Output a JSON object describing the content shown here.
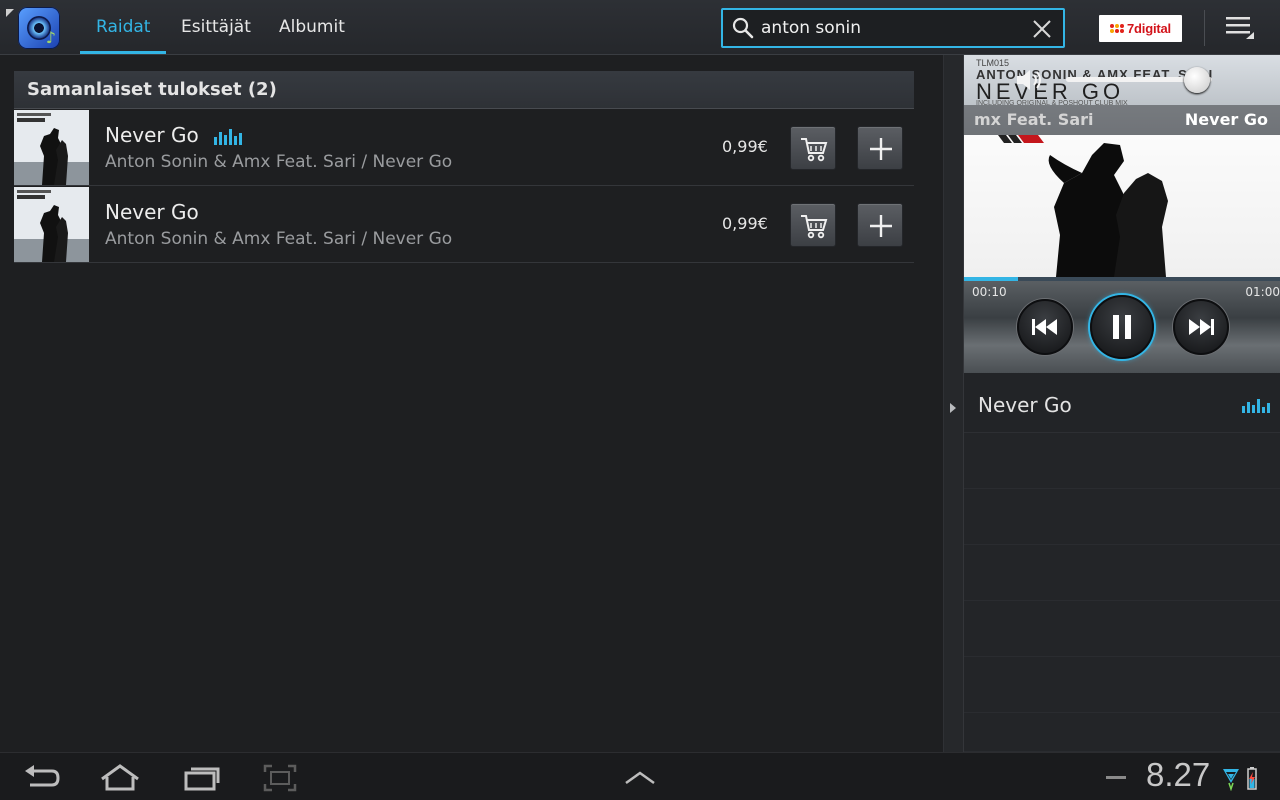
{
  "app": {
    "icon_name": "music-app-icon",
    "tabs": [
      {
        "label": "Raidat",
        "active": true
      },
      {
        "label": "Esittäjät",
        "active": false
      },
      {
        "label": "Albumit",
        "active": false
      }
    ],
    "search": {
      "value": "anton sonin"
    },
    "store_logo": {
      "text": "7digital"
    },
    "accent_color": "#33b5e5"
  },
  "results": {
    "header": "Samanlaiset tulokset (2)",
    "items": [
      {
        "title": "Never Go",
        "subtitle": "Anton Sonin & Amx Feat. Sari / Never Go",
        "price": "0,99€",
        "now_playing": true
      },
      {
        "title": "Never Go",
        "subtitle": "Anton Sonin & Amx Feat. Sari / Never Go",
        "price": "0,99€",
        "now_playing": false
      }
    ]
  },
  "player": {
    "artist_partial": "mx Feat. Sari",
    "track": "Never Go",
    "art": {
      "catalog": "TLM015",
      "artist_line": "ANTON SONIN & AMX FEAT. SARI",
      "title": "NEVER GO",
      "tagline": "INCLUDING ORIGINAL & POSHOUT CLUB MIX"
    },
    "volume": 0.9,
    "progress": 0.17,
    "time_current": "00:10",
    "time_total": "01:00",
    "state": "playing"
  },
  "queue": {
    "items": [
      {
        "title": "Never Go",
        "now_playing": true
      }
    ]
  },
  "system": {
    "clock": "8.27"
  }
}
